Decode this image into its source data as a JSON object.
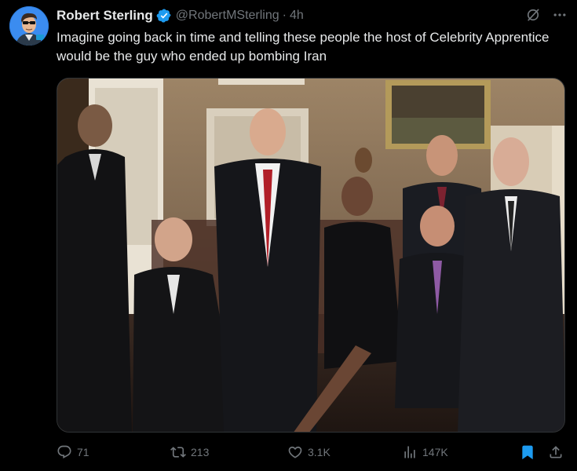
{
  "author": {
    "display_name": "Robert Sterling",
    "handle": "@RobertMSterling",
    "separator": "·",
    "time": "4h",
    "verified": true
  },
  "post": {
    "text": "Imagine going back in time and telling these people the host of Celebrity Apprentice would be the guy who ended up bombing Iran"
  },
  "media": {
    "icon": "photo-image"
  },
  "metrics": {
    "replies": "71",
    "reposts": "213",
    "likes": "3.1K",
    "views": "147K"
  },
  "colors": {
    "background": "#000000",
    "text_primary": "#e7e9ea",
    "text_secondary": "#71767b",
    "verified": "#1d9bf0",
    "bookmark_active": "#1d9bf0"
  }
}
